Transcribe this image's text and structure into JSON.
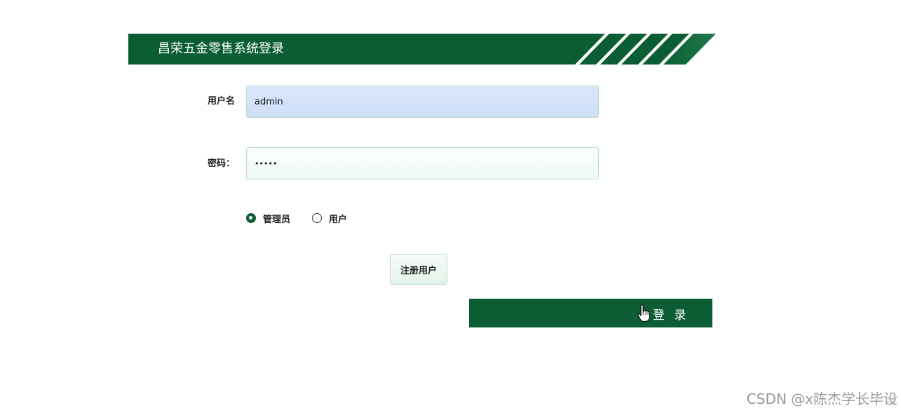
{
  "header": {
    "title": "昌荣五金零售系统登录",
    "color": "#0b5e33"
  },
  "form": {
    "username_label": "用户名",
    "username_value": "admin",
    "password_label": "密码：",
    "password_value": "•••••",
    "roles": [
      {
        "label": "管理员",
        "checked": true
      },
      {
        "label": "用户",
        "checked": false
      }
    ],
    "register_label": "注册用户",
    "login_label": "登 录"
  },
  "watermark": "CSDN @x陈杰学长毕设"
}
